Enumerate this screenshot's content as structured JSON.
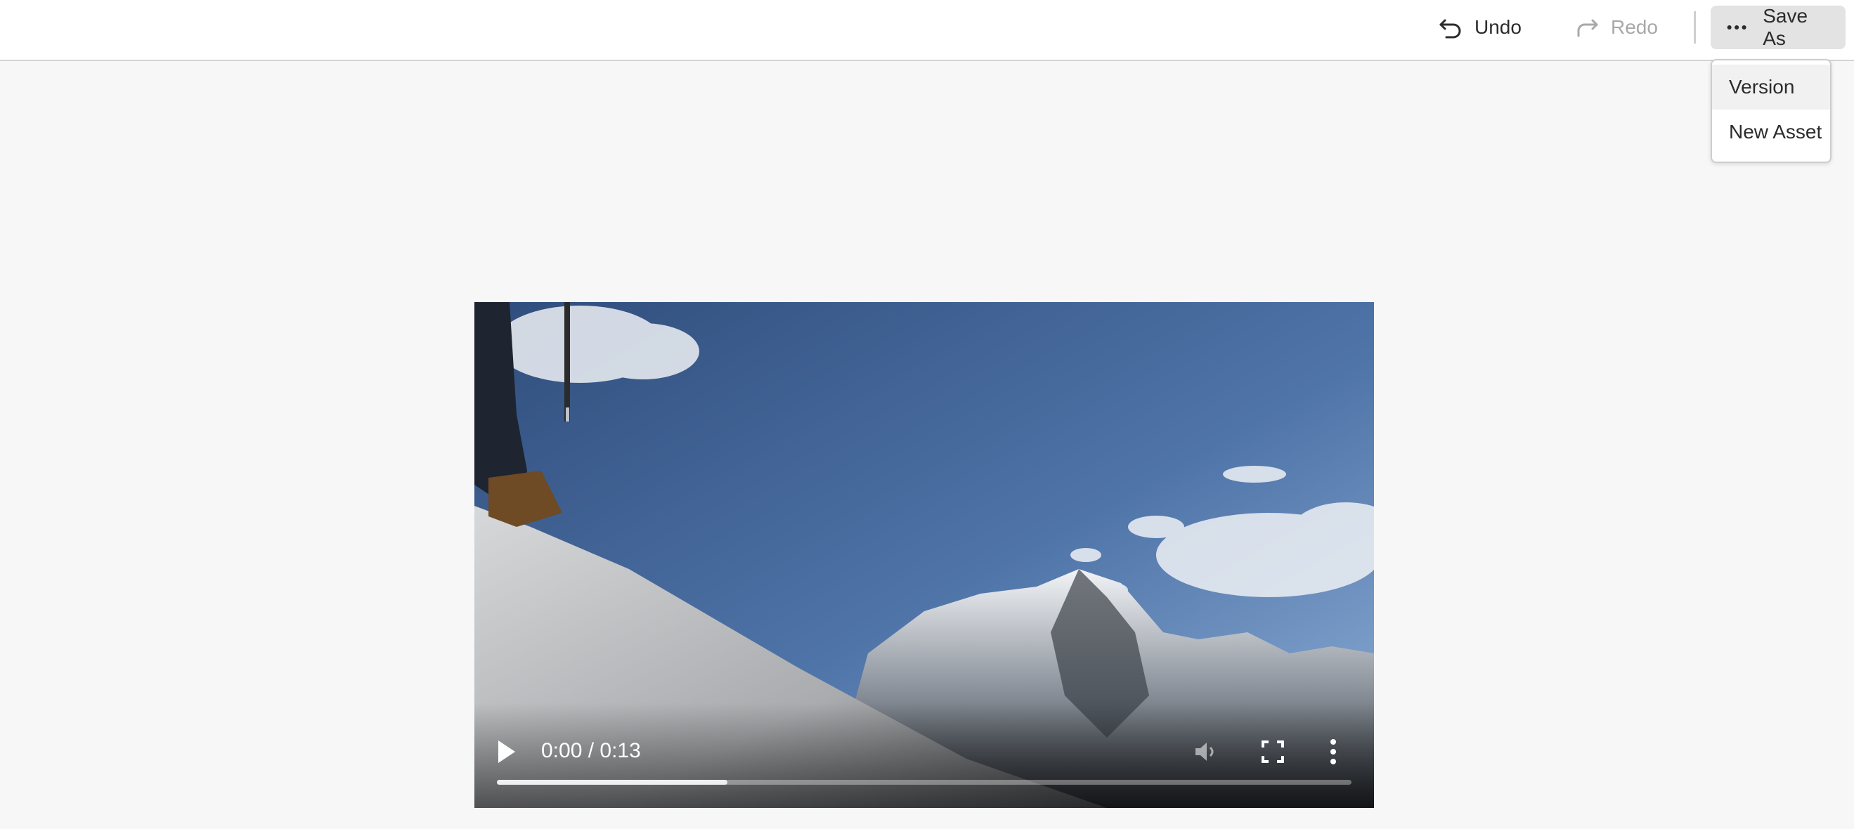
{
  "toolbar": {
    "undo_label": "Undo",
    "undo_icon": "undo-icon",
    "redo_label": "Redo",
    "redo_icon": "redo-icon",
    "save_as_label": "Save As",
    "save_as_icon": "more-horizontal-icon"
  },
  "save_as_menu": {
    "items": [
      {
        "label": "Version",
        "highlighted": true
      },
      {
        "label": "New Asset",
        "highlighted": false
      }
    ]
  },
  "video": {
    "current_time": "0:00",
    "duration": "0:13",
    "timecode": "0:00 / 0:13",
    "buffered_fraction": 0.27,
    "muted": true
  },
  "colors": {
    "page_background": "#f7f7f7",
    "toolbar_background": "#ffffff",
    "save_as_background": "#e3e3e3",
    "disabled_text": "#a8a8a8"
  }
}
